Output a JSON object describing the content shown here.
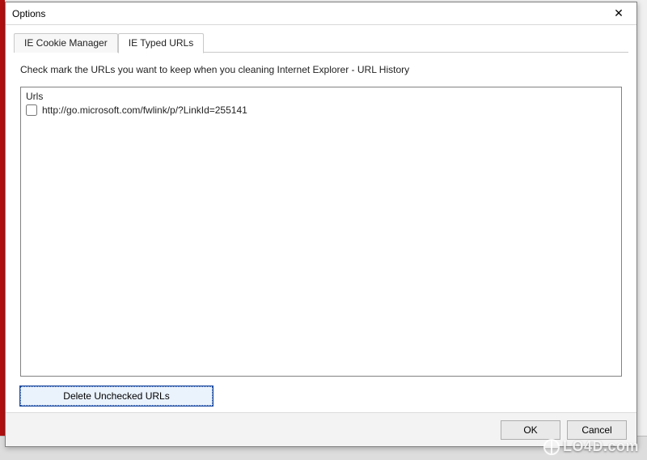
{
  "window": {
    "title": "Options",
    "close_symbol": "✕"
  },
  "tabs": [
    {
      "label": "IE Cookie Manager",
      "active": false
    },
    {
      "label": "IE Typed URLs",
      "active": true
    }
  ],
  "instruction": "Check mark the URLs you want to keep when you cleaning Internet Explorer - URL History",
  "list": {
    "header": "Urls",
    "items": [
      {
        "checked": false,
        "url": "http://go.microsoft.com/fwlink/p/?LinkId=255141"
      }
    ]
  },
  "buttons": {
    "delete": "Delete Unchecked URLs",
    "ok": "OK",
    "cancel": "Cancel"
  },
  "watermark": "LO4D.com"
}
